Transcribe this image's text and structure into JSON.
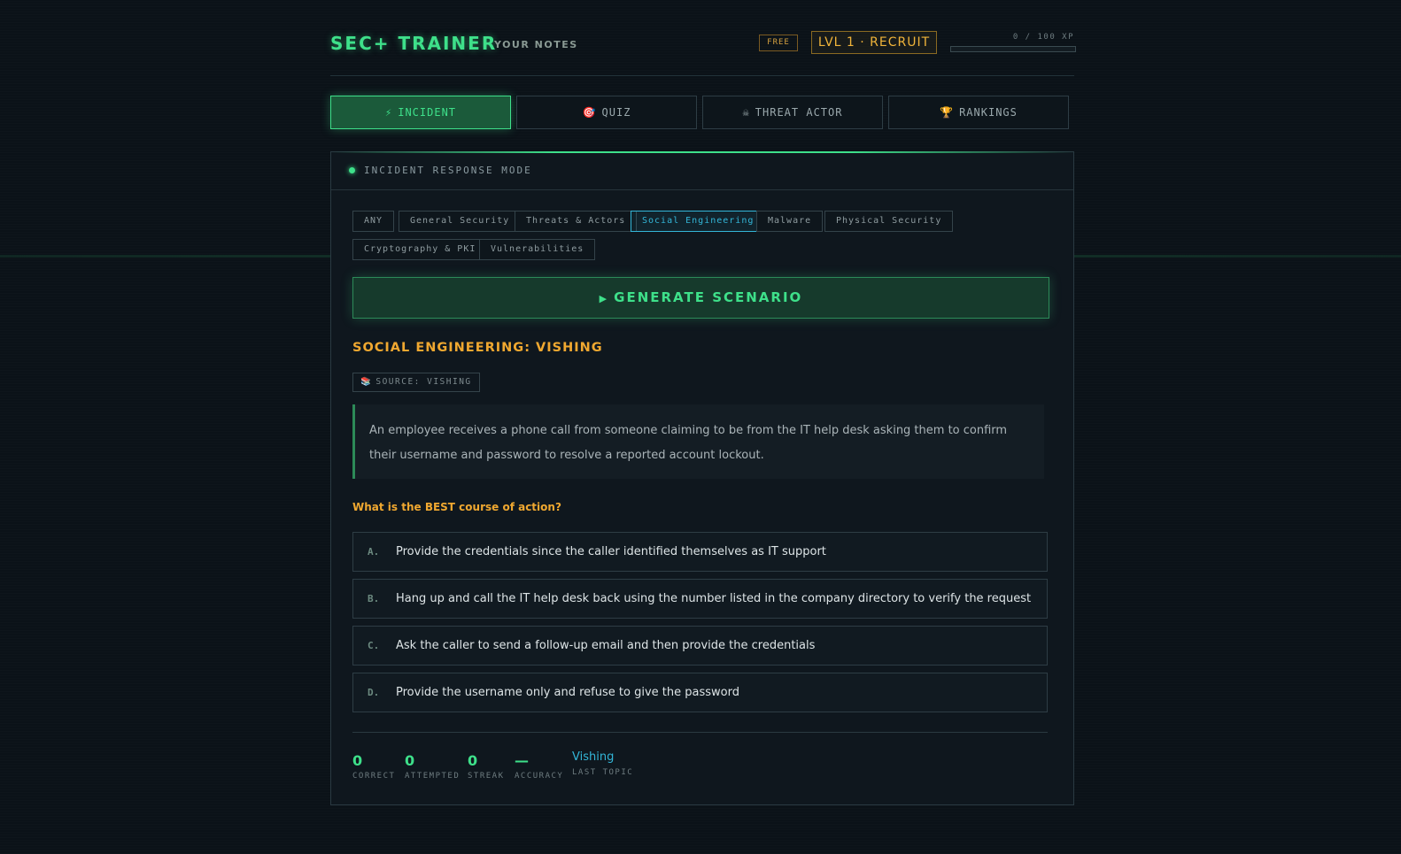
{
  "header": {
    "brand": "SEC+ TRAINER",
    "subtitle": "YOUR NOTES",
    "plan_badge": "FREE",
    "level": "LVL 1 · RECRUIT",
    "xp_text": "0 / 100 XP",
    "xp_progress": 0
  },
  "tabs": [
    {
      "icon": "⚡",
      "label": "INCIDENT",
      "active": true
    },
    {
      "icon": "🎯",
      "label": "QUIZ",
      "active": false
    },
    {
      "icon": "☠",
      "label": "THREAT ACTOR",
      "active": false
    },
    {
      "icon": "🏆",
      "label": "RANKINGS",
      "active": false
    }
  ],
  "panel": {
    "mode_label": "INCIDENT RESPONSE MODE",
    "categories": [
      {
        "label": "ANY",
        "active": false
      },
      {
        "label": "General Security",
        "active": false
      },
      {
        "label": "Threats & Actors",
        "active": false
      },
      {
        "label": "Social Engineering",
        "active": true
      },
      {
        "label": "Malware",
        "active": false
      },
      {
        "label": "Physical Security",
        "active": false
      },
      {
        "label": "Cryptography & PKI",
        "active": false
      },
      {
        "label": "Vulnerabilities",
        "active": false
      }
    ],
    "generate_label": "GENERATE SCENARIO",
    "scenario": {
      "title": "SOCIAL ENGINEERING: VISHING",
      "source_icon": "📚",
      "source": "SOURCE: VISHING",
      "text": "An employee receives a phone call from someone claiming to be from the IT help desk asking them to confirm their username and password to resolve a reported account lockout.",
      "question": "What is the BEST course of action?",
      "options": [
        {
          "letter": "A.",
          "text": "Provide the credentials since the caller identified themselves as IT support"
        },
        {
          "letter": "B.",
          "text": "Hang up and call the IT help desk back using the number listed in the company directory to verify the request"
        },
        {
          "letter": "C.",
          "text": "Ask the caller to send a follow-up email and then provide the credentials"
        },
        {
          "letter": "D.",
          "text": "Provide the username only and refuse to give the password"
        }
      ]
    },
    "stats": {
      "correct": {
        "value": "0",
        "label": "CORRECT"
      },
      "attempted": {
        "value": "0",
        "label": "ATTEMPTED"
      },
      "streak": {
        "value": "0",
        "label": "STREAK"
      },
      "accuracy": {
        "value": "—",
        "label": "ACCURACY"
      },
      "last_topic": {
        "value": "Vishing",
        "label": "LAST TOPIC"
      }
    }
  },
  "colors": {
    "accent_green": "#3ee08a",
    "accent_amber": "#f0a830",
    "accent_cyan": "#33b6d8",
    "background": "#0b1218"
  }
}
